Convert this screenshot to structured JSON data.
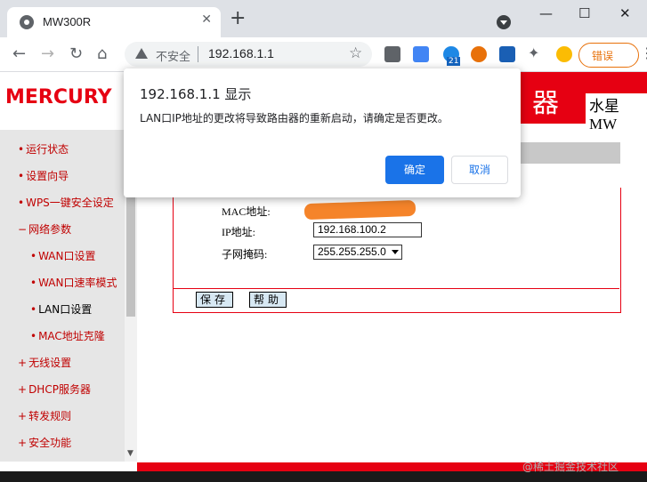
{
  "browser": {
    "tab_title": "MW300R",
    "tab_close": "✕",
    "new_tab": "+",
    "window_controls": [
      "—",
      "☐",
      "✕"
    ],
    "security_label": "不安全",
    "url": "192.168.1.1",
    "error_button": "错误",
    "badge_count": "21"
  },
  "router": {
    "brand": "MERCURY",
    "banner_char": "器",
    "model_text": "水星 MW"
  },
  "sidebar": {
    "items": [
      {
        "bullet": "•",
        "label": "运行状态"
      },
      {
        "bullet": "•",
        "label": "设置向导"
      },
      {
        "bullet": "•",
        "label": "WPS一键安全设定"
      },
      {
        "bullet": "−",
        "label": "网络参数"
      },
      {
        "bullet": "•",
        "label": "WAN口设置"
      },
      {
        "bullet": "•",
        "label": "WAN口速率模式"
      },
      {
        "bullet": "•",
        "label": "LAN口设置"
      },
      {
        "bullet": "•",
        "label": "MAC地址克隆"
      },
      {
        "bullet": "+",
        "label": "无线设置"
      },
      {
        "bullet": "+",
        "label": "DHCP服务器"
      },
      {
        "bullet": "+",
        "label": "转发规则"
      },
      {
        "bullet": "+",
        "label": "安全功能"
      }
    ]
  },
  "lan_form": {
    "mac_label": "MAC地址:",
    "ip_label": "IP地址:",
    "ip_value": "192.168.100.2",
    "mask_label": "子网掩码:",
    "mask_value": "255.255.255.0",
    "save_button": "保存",
    "help_button": "帮助"
  },
  "dialog": {
    "title": "192.168.1.1 显示",
    "message": "LAN口IP地址的更改将导致路由器的重新启动，请确定是否更改。",
    "ok_label": "确定",
    "cancel_label": "取消"
  },
  "watermark": "@稀土掘金技术社区",
  "colors": {
    "brand_red": "#e60012",
    "primary_blue": "#1a73e8",
    "warning_orange": "#e8710a"
  }
}
